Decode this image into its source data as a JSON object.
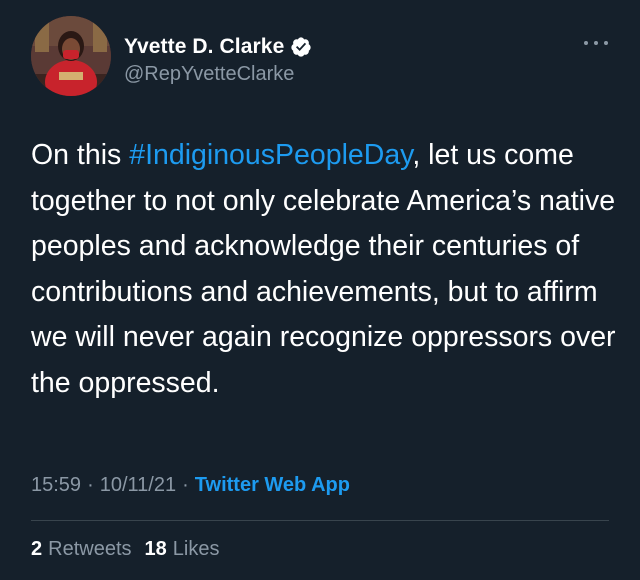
{
  "author": {
    "display_name": "Yvette D. Clarke",
    "handle": "@RepYvetteClarke",
    "verified": true,
    "verified_icon": "verified-badge-icon"
  },
  "tweet": {
    "text_before": "On this ",
    "hashtag": "#IndiginousPeopleDay",
    "text_after": ", let us come together to not only celebrate America’s native peoples and acknowledge their centuries of contributions and achievements, but to affirm we will never again recognize oppressors over the oppressed."
  },
  "meta": {
    "time": "15:59",
    "separator": "·",
    "date": "10/11/21",
    "source": "Twitter Web App"
  },
  "stats": {
    "retweets_count": "2",
    "retweets_label": "Retweets",
    "likes_count": "18",
    "likes_label": "Likes"
  },
  "colors": {
    "background": "#15202b",
    "primary_text": "#ffffff",
    "secondary_text": "#8b98a5",
    "accent": "#1d9bf0",
    "divider": "#38444d"
  }
}
